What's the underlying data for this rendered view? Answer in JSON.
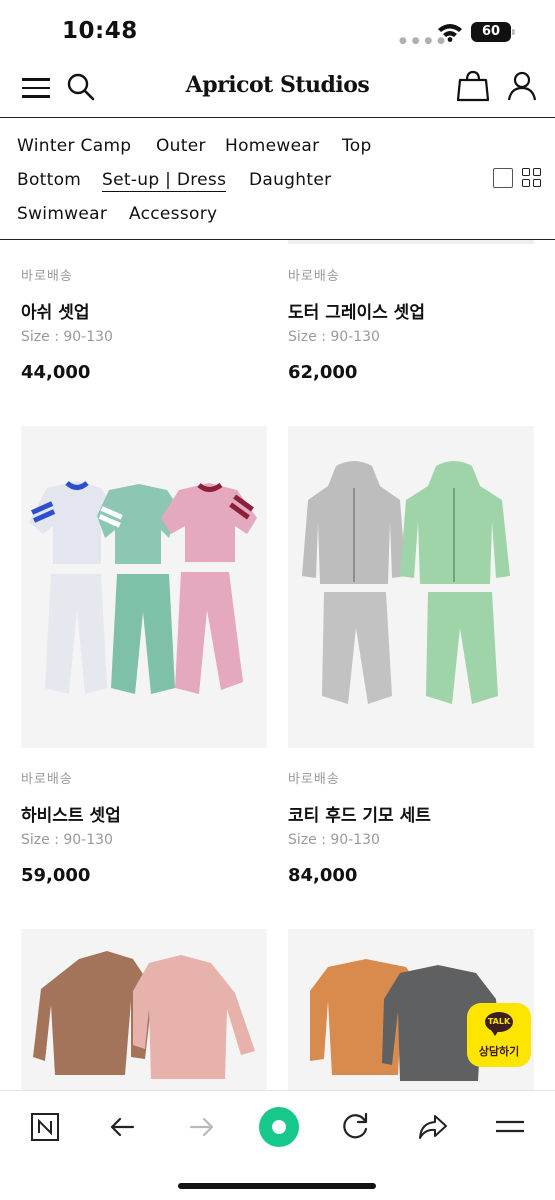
{
  "status": {
    "time": "10:48",
    "battery": "60"
  },
  "header": {
    "logo": "Apricot Studios"
  },
  "categories": [
    {
      "label": "Winter Camp"
    },
    {
      "label": "Outer"
    },
    {
      "label": "Homewear"
    },
    {
      "label": "Top"
    },
    {
      "label": "Bottom"
    },
    {
      "label": "Set-up | Dress",
      "active": true
    },
    {
      "label": "Daughter"
    },
    {
      "label": "Swimwear"
    },
    {
      "label": "Accessory"
    }
  ],
  "products": [
    {
      "shipping": "바로배송",
      "name": "아쉬 셋업",
      "size": "Size : 90-130",
      "price": "44,000"
    },
    {
      "shipping": "바로배송",
      "name": "도터 그레이스 셋업",
      "size": "Size : 90-130",
      "price": "62,000"
    },
    {
      "shipping": "바로배송",
      "name": "하비스트 셋업",
      "size": "Size : 90-130",
      "price": "59,000"
    },
    {
      "shipping": "바로배송",
      "name": "코티 후드 기모 세트",
      "size": "Size : 90-130",
      "price": "84,000"
    }
  ],
  "kakao": {
    "bubble": "TALK",
    "label": "상담하기"
  },
  "colors": {
    "accent_green": "#16c88a",
    "kakao_yellow": "#fde500",
    "sweat_blue_trim": "#2c4fd0",
    "sweat_mint": "#8cc7b3",
    "sweat_pink": "#e4a9be",
    "hood_grey": "#bdbdbd",
    "hood_green": "#9fd4a8",
    "velour_brown": "#a4745a",
    "velour_pink": "#e7b2ac",
    "sweat_orange": "#d98b4d",
    "sweat_charcoal": "#5f6062"
  }
}
